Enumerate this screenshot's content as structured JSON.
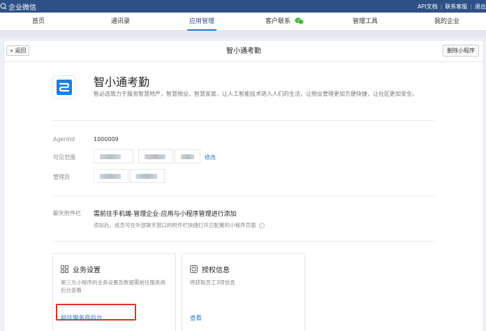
{
  "header": {
    "logo_text": "企业微信",
    "links": [
      "API文档",
      "联系客服",
      "退出"
    ]
  },
  "nav": {
    "items": [
      {
        "label": "首页"
      },
      {
        "label": "通讯录"
      },
      {
        "label": "应用管理"
      },
      {
        "label": "客户联系"
      },
      {
        "label": "管理工具"
      },
      {
        "label": "我的企业"
      }
    ],
    "active": "应用管理"
  },
  "panel": {
    "back_label": "« 返回",
    "title": "智小通考勤",
    "delete_label": "删除小程序"
  },
  "app": {
    "name": "智小通考勤",
    "description": "智必选致力于服务智慧地产，智慧物业，智慧家庭，让人工智能技术进入人们的生活，让物业管理更加方便快捷，让社区更加安全。",
    "agentid_label": "AgentId",
    "agentid_value": "1000009",
    "visible_label": "可见范围",
    "modify_label": "修改",
    "admin_label": "管理员"
  },
  "chat_attach": {
    "label": "聊天附件栏",
    "title": "需前往手机端-管理企业-应用与小程序管理进行添加",
    "subtitle": "添加后，成员可在外部聊天窗口的附件栏快捷打开已配置的小程序页面"
  },
  "cards": [
    {
      "title": "业务设置",
      "icon": "grid-icon",
      "desc": "第三方小程序的业务设置及数据需前往服务商后台查看",
      "link": "前往服务商后台"
    },
    {
      "title": "授权信息",
      "icon": "authorize-icon",
      "desc": "将获取员工3项信息",
      "link": "查看"
    }
  ],
  "colors": {
    "topbar": "#2d5087",
    "accent": "#2d78c8",
    "highlight": "#e0301e"
  }
}
